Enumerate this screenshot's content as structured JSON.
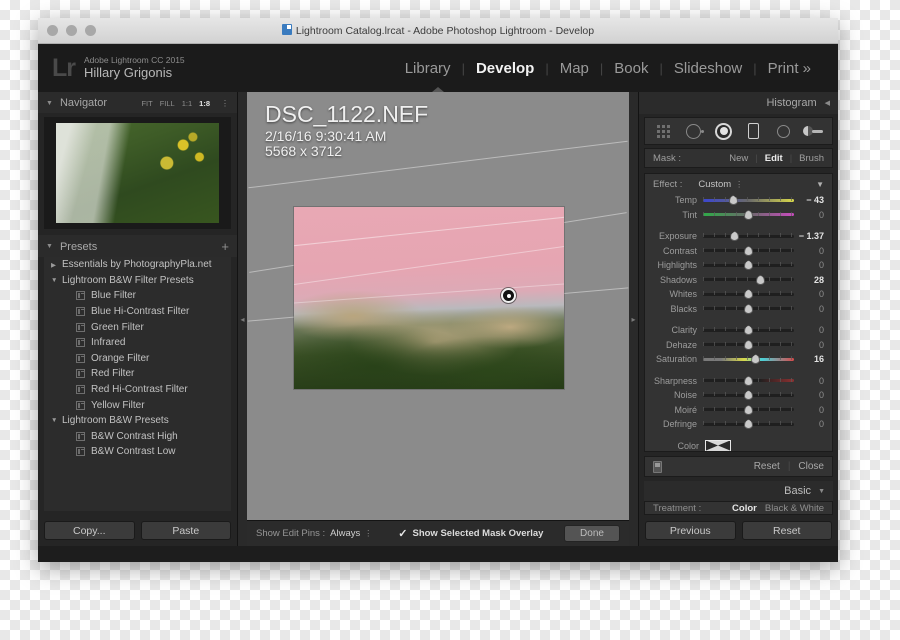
{
  "titlebar": {
    "title": "Lightroom Catalog.lrcat - Adobe Photoshop Lightroom - Develop"
  },
  "header": {
    "logo": "Lr",
    "product": "Adobe Lightroom CC 2015",
    "user": "Hillary Grigonis",
    "modules": [
      {
        "label": "Library",
        "active": false
      },
      {
        "label": "Develop",
        "active": true
      },
      {
        "label": "Map",
        "active": false
      },
      {
        "label": "Book",
        "active": false
      },
      {
        "label": "Slideshow",
        "active": false
      },
      {
        "label": "Print »",
        "active": false
      }
    ],
    "separator": "|"
  },
  "navigator": {
    "title": "Navigator",
    "zoom_options": [
      "FIT",
      "FILL",
      "1:1"
    ],
    "zoom_selected": "1:8"
  },
  "presets": {
    "title": "Presets",
    "add": "+",
    "items": [
      {
        "label": "Essentials by PhotographyPla.net",
        "type": "group",
        "expanded": false
      },
      {
        "label": "Lightroom B&W Filter Presets",
        "type": "group",
        "expanded": true
      },
      {
        "label": "Blue Filter",
        "type": "item"
      },
      {
        "label": "Blue Hi-Contrast Filter",
        "type": "item"
      },
      {
        "label": "Green Filter",
        "type": "item"
      },
      {
        "label": "Infrared",
        "type": "item"
      },
      {
        "label": "Orange Filter",
        "type": "item"
      },
      {
        "label": "Red Filter",
        "type": "item"
      },
      {
        "label": "Red Hi-Contrast Filter",
        "type": "item"
      },
      {
        "label": "Yellow Filter",
        "type": "item"
      },
      {
        "label": "Lightroom B&W Presets",
        "type": "group",
        "expanded": true
      },
      {
        "label": "B&W Contrast High",
        "type": "item"
      },
      {
        "label": "B&W Contrast Low",
        "type": "item"
      }
    ]
  },
  "left_buttons": {
    "copy": "Copy...",
    "paste": "Paste"
  },
  "photo": {
    "name": "DSC_1122.NEF",
    "date": "2/16/16 9:30:41 AM",
    "dimensions": "5568 x 3712"
  },
  "toolbar": {
    "edit_pins_label": "Show Edit Pins :",
    "edit_pins_value": "Always",
    "overlay_label": "Show Selected Mask Overlay",
    "overlay_checked": true,
    "done": "Done"
  },
  "right": {
    "histogram_title": "Histogram",
    "tools": [
      "crop-overlay-tool",
      "spot-removal-tool",
      "radial-filter-tool",
      "graduated-filter-tool",
      "adjustment-brush-tool"
    ],
    "active_tool": "radial-filter-tool",
    "mask_label": "Mask :",
    "mask_options": [
      {
        "label": "New",
        "active": false
      },
      {
        "label": "Edit",
        "active": true
      },
      {
        "label": "Brush",
        "active": false
      }
    ],
    "effect_label": "Effect :",
    "effect_value": "Custom",
    "sliders": [
      {
        "label": "Temp",
        "value": "− 43",
        "pos": 33,
        "bar": "temp",
        "highlight": true
      },
      {
        "label": "Tint",
        "value": "0",
        "pos": 50,
        "bar": "tint",
        "highlight": false
      },
      {
        "label": "Exposure",
        "value": "− 1.37",
        "pos": 35,
        "bar": "",
        "highlight": true
      },
      {
        "label": "Contrast",
        "value": "0",
        "pos": 50,
        "bar": "",
        "highlight": false
      },
      {
        "label": "Highlights",
        "value": "0",
        "pos": 50,
        "bar": "",
        "highlight": false
      },
      {
        "label": "Shadows",
        "value": "28",
        "pos": 63,
        "bar": "",
        "highlight": true
      },
      {
        "label": "Whites",
        "value": "0",
        "pos": 50,
        "bar": "",
        "highlight": false
      },
      {
        "label": "Blacks",
        "value": "0",
        "pos": 50,
        "bar": "",
        "highlight": false
      },
      {
        "label": "Clarity",
        "value": "0",
        "pos": 50,
        "bar": "",
        "highlight": false
      },
      {
        "label": "Dehaze",
        "value": "0",
        "pos": 50,
        "bar": "",
        "highlight": false
      },
      {
        "label": "Saturation",
        "value": "16",
        "pos": 58,
        "bar": "sat",
        "highlight": true
      },
      {
        "label": "Sharpness",
        "value": "0",
        "pos": 50,
        "bar": "sharp",
        "highlight": false
      },
      {
        "label": "Noise",
        "value": "0",
        "pos": 50,
        "bar": "",
        "highlight": false
      },
      {
        "label": "Moiré",
        "value": "0",
        "pos": 50,
        "bar": "",
        "highlight": false
      },
      {
        "label": "Defringe",
        "value": "0",
        "pos": 50,
        "bar": "",
        "highlight": false
      }
    ],
    "color_label": "Color",
    "reset": "Reset",
    "close": "Close",
    "basic_title": "Basic",
    "treatment_label": "Treatment :",
    "treatment_options": [
      {
        "label": "Color",
        "active": true
      },
      {
        "label": "Black & White",
        "active": false
      }
    ]
  },
  "right_buttons": {
    "previous": "Previous",
    "reset": "Reset"
  }
}
